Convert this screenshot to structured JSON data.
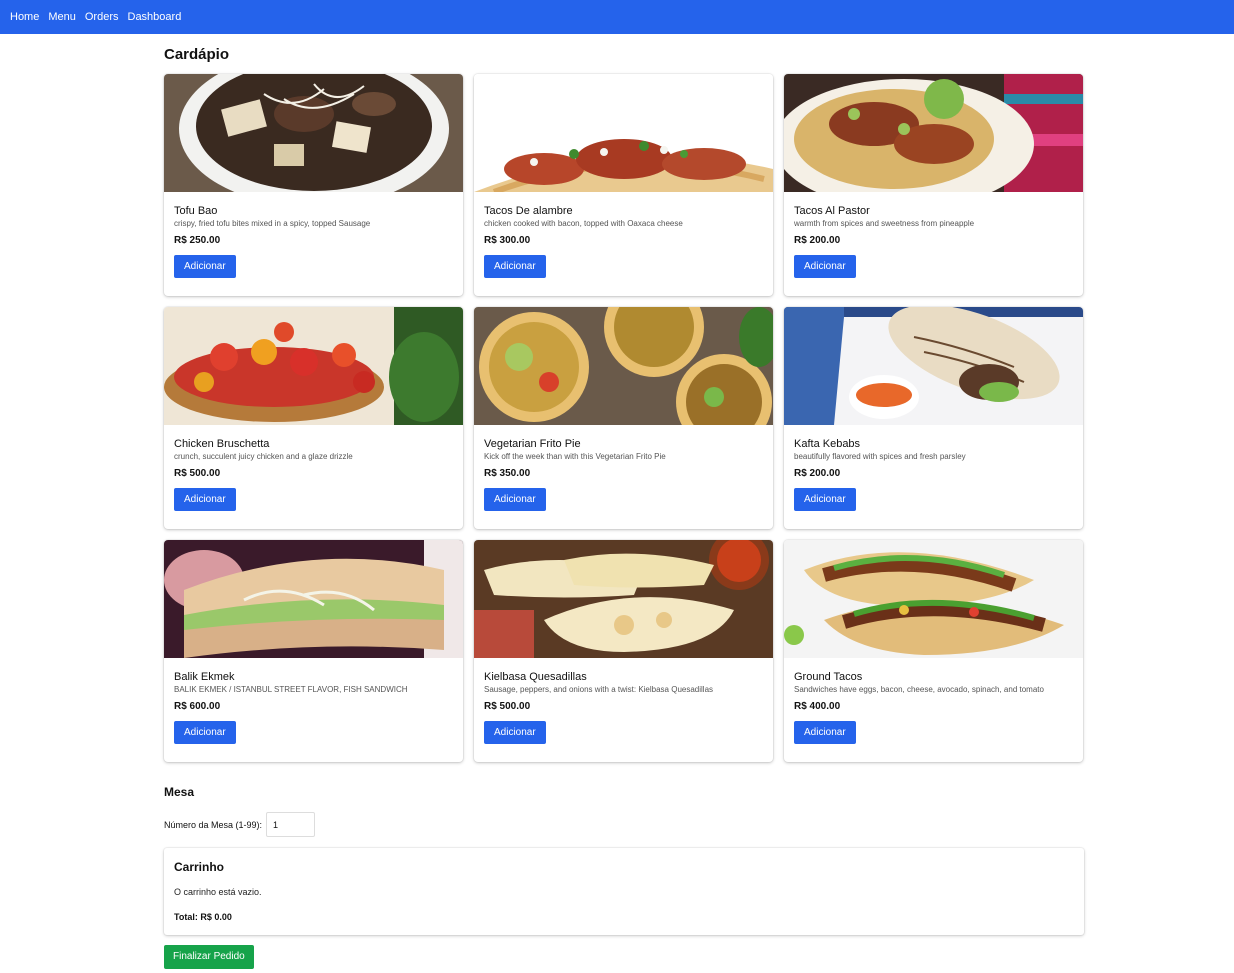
{
  "nav": {
    "items": [
      {
        "label": "Home"
      },
      {
        "label": "Menu"
      },
      {
        "label": "Orders"
      },
      {
        "label": "Dashboard"
      }
    ]
  },
  "page": {
    "title": "Cardápio"
  },
  "menu": {
    "items": [
      {
        "name": "Tofu Bao",
        "description": "crispy, fried tofu bites mixed in a spicy, topped Sausage",
        "price": "R$ 250.00",
        "button": "Adicionar",
        "image": "tofu-soup-image"
      },
      {
        "name": "Tacos De alambre",
        "description": "chicken cooked with bacon, topped with Oaxaca cheese",
        "price": "R$ 300.00",
        "button": "Adicionar",
        "image": "tacos-image"
      },
      {
        "name": "Tacos Al Pastor",
        "description": "warmth from spices and sweetness from pineapple",
        "price": "R$ 200.00",
        "button": "Adicionar",
        "image": "tacos-al-pastor-image"
      },
      {
        "name": "Chicken Bruschetta",
        "description": "crunch, succulent juicy chicken and a glaze drizzle",
        "price": "R$ 500.00",
        "button": "Adicionar",
        "image": "bruschetta-image"
      },
      {
        "name": "Vegetarian Frito Pie",
        "description": "Kick off the week than with this Vegetarian Frito Pie",
        "price": "R$ 350.00",
        "button": "Adicionar",
        "image": "frito-pie-image"
      },
      {
        "name": "Kafta Kebabs",
        "description": "beautifully flavored with spices and fresh parsley",
        "price": "R$ 200.00",
        "button": "Adicionar",
        "image": "wrap-image"
      },
      {
        "name": "Balik Ekmek",
        "description": "BALIK EKMEK / ISTANBUL STREET FLAVOR, FISH SANDWICH",
        "price": "R$ 600.00",
        "button": "Adicionar",
        "image": "fish-sandwich-image"
      },
      {
        "name": "Kielbasa Quesadillas",
        "description": "Sausage, peppers, and onions with a twist: Kielbasa Quesadillas",
        "price": "R$ 500.00",
        "button": "Adicionar",
        "image": "quesadilla-image"
      },
      {
        "name": "Ground Tacos",
        "description": "Sandwiches have eggs, bacon, cheese, avocado, spinach, and tomato",
        "price": "R$ 400.00",
        "button": "Adicionar",
        "image": "ground-tacos-image"
      }
    ]
  },
  "table": {
    "title": "Mesa",
    "label": "Número da Mesa (1-99):",
    "value": "1"
  },
  "cart": {
    "title": "Carrinho",
    "empty": "O carrinho está vazio.",
    "total": "Total: R$ 0.00"
  },
  "checkout": {
    "label": "Finalizar Pedido"
  },
  "colors": {
    "primary": "#2563eb",
    "success": "#16a34a"
  }
}
